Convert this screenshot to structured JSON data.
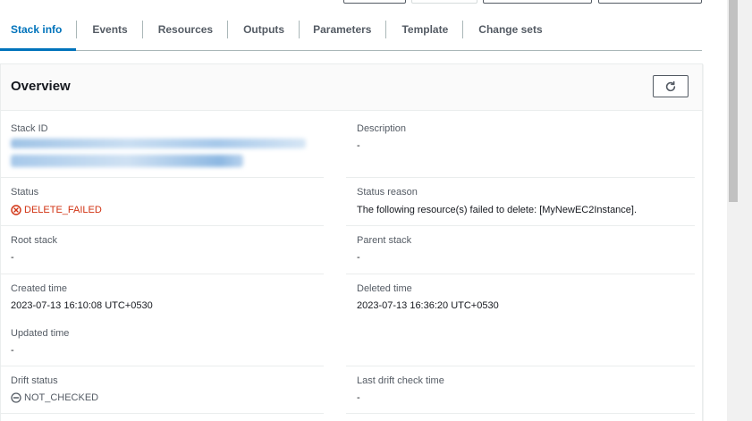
{
  "tabs": [
    {
      "label": "Stack info",
      "active": true
    },
    {
      "label": "Events"
    },
    {
      "label": "Resources"
    },
    {
      "label": "Outputs"
    },
    {
      "label": "Parameters"
    },
    {
      "label": "Template"
    },
    {
      "label": "Change sets"
    }
  ],
  "panel": {
    "title": "Overview",
    "refresh_icon": "refresh-icon"
  },
  "fields": {
    "stack_id": {
      "label": "Stack ID",
      "value_hidden": true
    },
    "description": {
      "label": "Description",
      "value": "-"
    },
    "status": {
      "label": "Status",
      "value": "DELETE_FAILED",
      "icon": "error-icon",
      "color": "#d13212"
    },
    "status_reason": {
      "label": "Status reason",
      "value": "The following resource(s) failed to delete: [MyNewEC2Instance]."
    },
    "root_stack": {
      "label": "Root stack",
      "value": "-"
    },
    "parent_stack": {
      "label": "Parent stack",
      "value": "-"
    },
    "created_time": {
      "label": "Created time",
      "value": "2023-07-13 16:10:08 UTC+0530"
    },
    "deleted_time": {
      "label": "Deleted time",
      "value": "2023-07-13 16:36:20 UTC+0530"
    },
    "updated_time": {
      "label": "Updated time",
      "value": "-"
    },
    "drift_status": {
      "label": "Drift status",
      "value": "NOT_CHECKED",
      "icon": "not-checked-icon"
    },
    "last_drift_check": {
      "label": "Last drift check time",
      "value": "-"
    }
  },
  "colors": {
    "accent": "#0073bb",
    "error": "#d13212",
    "label": "#545b64"
  }
}
